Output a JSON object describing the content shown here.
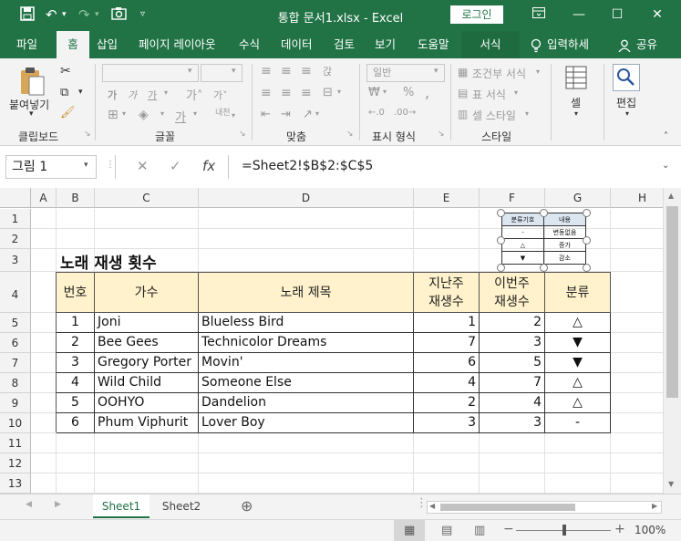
{
  "window": {
    "title": "통합 문서1.xlsx - Excel",
    "login_label": "로그인"
  },
  "menu": {
    "tabs": [
      "파일",
      "홈",
      "삽입",
      "페이지 레이아웃",
      "수식",
      "데이터",
      "검토",
      "보기",
      "도움말",
      "서식"
    ],
    "active_tab": "홈",
    "tell_me": "입력하세",
    "share": "공유"
  },
  "ribbon": {
    "paste_label": "붙여넣기",
    "clipboard_label": "클립보드",
    "font_label": "글꼴",
    "align_label": "맞춤",
    "number_label": "표시 형식",
    "number_format": "일반",
    "conditional_format": "조건부 서식",
    "table_format": "표 서식",
    "cell_style": "셀 스타일",
    "style_label": "스타일",
    "cells_label": "셀",
    "editing_label": "편집"
  },
  "formula_bar": {
    "name_box": "그림 1",
    "formula": "=Sheet2!$B$2:$C$5"
  },
  "grid": {
    "columns": [
      "A",
      "B",
      "C",
      "D",
      "E",
      "F",
      "G",
      "H"
    ],
    "rows": [
      "1",
      "2",
      "3",
      "4",
      "5",
      "6",
      "7",
      "8",
      "9",
      "10",
      "11",
      "12",
      "13"
    ]
  },
  "sheet": {
    "title": "노래 재생 횟수",
    "headers": {
      "no": "번호",
      "artist": "가수",
      "song": "노래 제목",
      "last_week_1": "지난주",
      "last_week_2": "재생수",
      "this_week_1": "이번주",
      "this_week_2": "재생수",
      "category": "분류"
    },
    "rows": [
      {
        "no": "1",
        "artist": "Joni",
        "song": "Blueless Bird",
        "last": "1",
        "this": "2",
        "cat": "△"
      },
      {
        "no": "2",
        "artist": "Bee Gees",
        "song": "Technicolor Dreams",
        "last": "7",
        "this": "3",
        "cat": "▼"
      },
      {
        "no": "3",
        "artist": "Gregory Porter",
        "song": "Movin'",
        "last": "6",
        "this": "5",
        "cat": "▼"
      },
      {
        "no": "4",
        "artist": "Wild Child",
        "song": "Someone Else",
        "last": "4",
        "this": "7",
        "cat": "△"
      },
      {
        "no": "5",
        "artist": "OOHYO",
        "song": "Dandelion",
        "last": "2",
        "this": "4",
        "cat": "△"
      },
      {
        "no": "6",
        "artist": "Phum Viphurit",
        "song": "Lover Boy",
        "last": "3",
        "this": "3",
        "cat": "-"
      }
    ]
  },
  "legend_picture": {
    "header_symbol": "분류기호",
    "header_content": "내용",
    "rows": [
      {
        "sym": "-",
        "text": "변동없음"
      },
      {
        "sym": "△",
        "text": "증가"
      },
      {
        "sym": "▼",
        "text": "감소"
      }
    ]
  },
  "sheet_tabs": [
    "Sheet1",
    "Sheet2"
  ],
  "status": {
    "zoom": "100%"
  }
}
